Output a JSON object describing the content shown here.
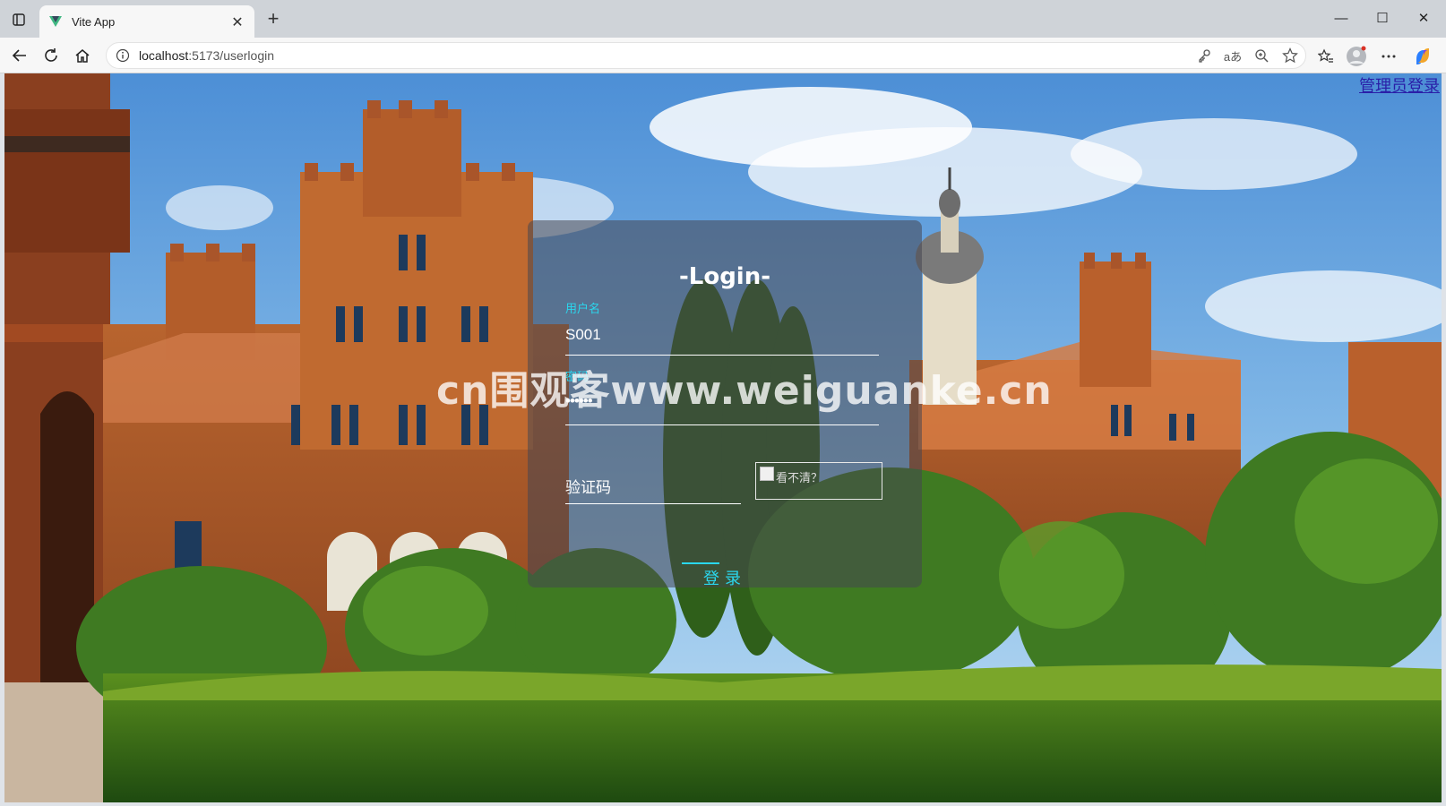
{
  "browser": {
    "tab_title": "Vite App",
    "tab_close": "✕",
    "new_tab": "+",
    "url_host": "localhost",
    "url_rest": ":5173/userlogin",
    "window_controls": {
      "minimize": "—",
      "maximize": "☐",
      "close": "✕"
    }
  },
  "page": {
    "admin_link": "管理员登录",
    "login": {
      "title": "-Login-",
      "username_label": "用户名",
      "username_value": "S001",
      "password_label": "密码",
      "password_value": "••••••",
      "captcha_placeholder": "验证码",
      "captcha_alt": "看不清？",
      "submit": "登录"
    },
    "watermark": "cn围观客www.weiguanke.cn"
  },
  "colors": {
    "accent": "#2ad7ee",
    "link": "#2a1fa8",
    "panel": "rgba(70,70,80,0.55)"
  }
}
